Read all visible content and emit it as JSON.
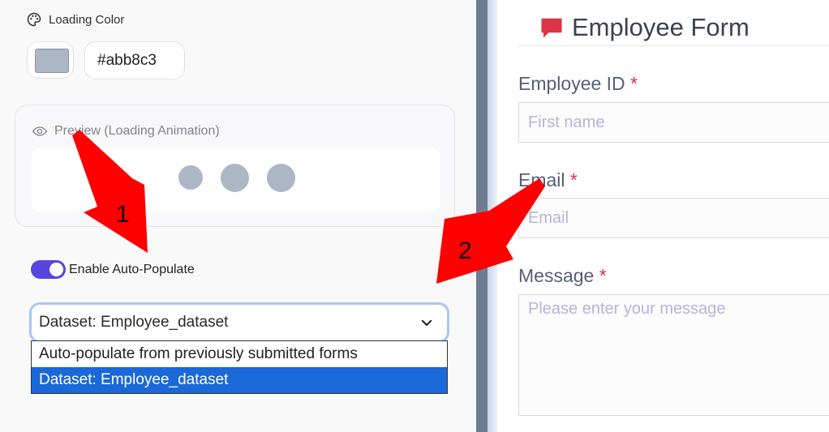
{
  "settings": {
    "loading_color_label": "Loading Color",
    "loading_color_value": "#abb8c3",
    "preview_label": "Preview (Loading Animation)",
    "auto_populate_label": "Enable Auto-Populate",
    "auto_populate_enabled": true,
    "dataset_select_value": "Dataset: Employee_dataset",
    "dataset_options": [
      "Auto-populate from previously submitted forms",
      "Dataset: Employee_dataset"
    ]
  },
  "annotations": {
    "arrow_1_label": "1",
    "arrow_2_label": "2"
  },
  "form": {
    "title": "Employee Form",
    "fields": [
      {
        "label": "Employee ID",
        "required_mark": "*",
        "placeholder": "First name"
      },
      {
        "label": "Email",
        "required_mark": "*",
        "placeholder": "Email"
      },
      {
        "label": "Message",
        "required_mark": "*",
        "placeholder": "Please enter your message"
      }
    ]
  },
  "colors": {
    "accent_toggle": "#5a44e0",
    "dropdown_selected": "#1a68d9",
    "title_icon": "#dc3545",
    "required": "#d2334e",
    "arrow": "#ff0000"
  }
}
